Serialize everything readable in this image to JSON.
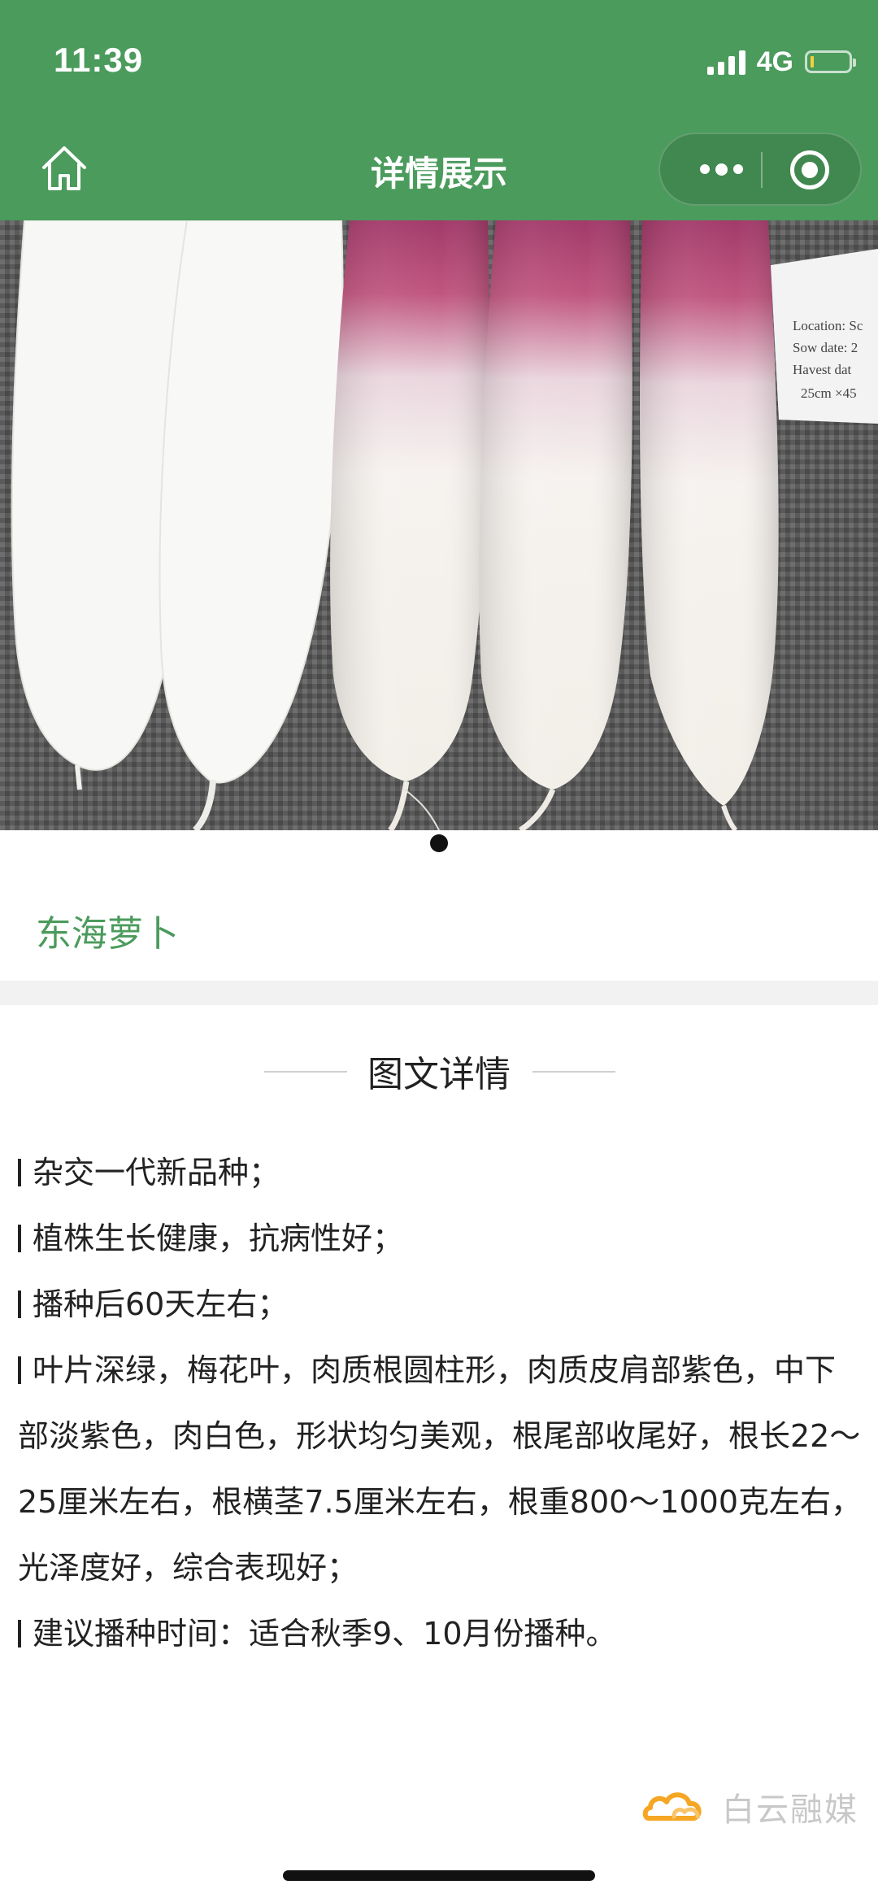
{
  "status_bar": {
    "time": "11:39",
    "network": "4G",
    "battery_color": "#f4d03f"
  },
  "nav": {
    "title": "详情展示",
    "home_icon": "home-icon",
    "more_icon": "more-dots-icon",
    "close_icon": "target-close-icon"
  },
  "gallery": {
    "image_label": [
      "Location: Sc",
      "Sow date: 2",
      "Havest dat",
      "25cm ×45"
    ],
    "indicator_count": 1,
    "active_index": 0
  },
  "product": {
    "name": "东海萝卜"
  },
  "details": {
    "section_title": "图文详情",
    "lines": [
      "杂交一代新品种；",
      "植株生长健康，抗病性好；",
      "播种后60天左右；",
      "叶片深绿，梅花叶，肉质根圆柱形，肉质皮肩部紫色，中下部淡紫色，肉白色，形状均匀美观，根尾部收尾好，根长22～25厘米左右，根横茎7.5厘米左右，根重800～1000克左右，光泽度好，综合表现好；",
      "建议播种时间：适合秋季9、10月份播种。"
    ]
  },
  "watermark": {
    "text": "白云融媒"
  },
  "colors": {
    "brand_green": "#4b9b5c"
  }
}
